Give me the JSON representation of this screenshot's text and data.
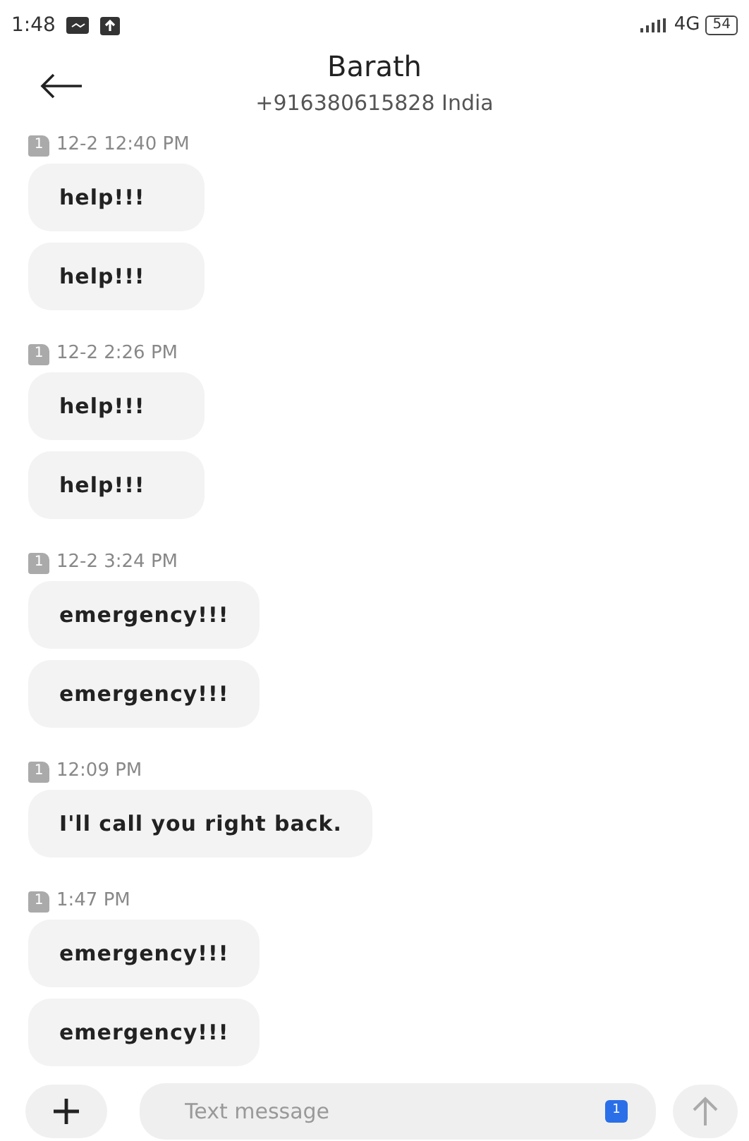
{
  "status_bar": {
    "time": "1:48",
    "network": "4G",
    "battery": "54"
  },
  "header": {
    "name": "Barath",
    "number": "+916380615828 India"
  },
  "groups": [
    {
      "sim": "1",
      "time": "12-2 12:40 PM",
      "messages": [
        "help!!!",
        "help!!!"
      ]
    },
    {
      "sim": "1",
      "time": "12-2 2:26 PM",
      "messages": [
        "help!!!",
        "help!!!"
      ]
    },
    {
      "sim": "1",
      "time": "12-2 3:24 PM",
      "messages": [
        "emergency!!!",
        "emergency!!!"
      ]
    },
    {
      "sim": "1",
      "time": "12:09 PM",
      "messages": [
        "I'll call you right back."
      ]
    },
    {
      "sim": "1",
      "time": "1:47 PM",
      "messages": [
        "emergency!!!",
        "emergency!!!"
      ]
    }
  ],
  "composer": {
    "placeholder": "Text message",
    "sim": "1"
  }
}
